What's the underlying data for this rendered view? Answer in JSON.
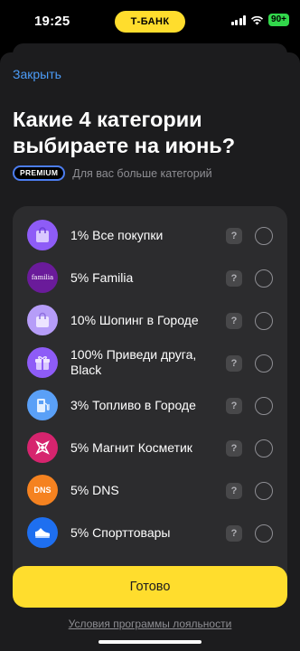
{
  "status": {
    "time": "19:25",
    "bank_label": "Т-БАНК",
    "battery": "90+"
  },
  "sheet": {
    "close_label": "Закрыть",
    "title": "Какие 4 категории выбираете на июнь?",
    "premium_badge": "PREMIUM",
    "premium_text": "Для вас больше категорий",
    "ready_label": "Готово",
    "terms_label": "Условия программы лояльности"
  },
  "categories": [
    {
      "label": "1% Все покупки",
      "icon": "shopping-bag-icon",
      "color": "#8e5cf7"
    },
    {
      "label": "5% Familia",
      "icon": "familia-logo",
      "icon_text": "familia",
      "color": "#6a1b9a"
    },
    {
      "label": "10% Шопинг в Городе",
      "icon": "shopping-bag-icon",
      "color": "#b69df8"
    },
    {
      "label": "100% Приведи друга, Black",
      "icon": "gift-icon",
      "color": "#8e5cf7"
    },
    {
      "label": "3% Топливо в Городе",
      "icon": "fuel-icon",
      "color": "#5aa0f7"
    },
    {
      "label": "5% Магнит Косметик",
      "icon": "magnit-cosmetic-icon",
      "color": "#d6246e"
    },
    {
      "label": "5% DNS",
      "icon": "dns-logo",
      "icon_text": "DNS",
      "color": "#f58220"
    },
    {
      "label": "5% Спорттовары",
      "icon": "sneaker-icon",
      "color": "#1e6ff0"
    }
  ],
  "question_mark": "?"
}
